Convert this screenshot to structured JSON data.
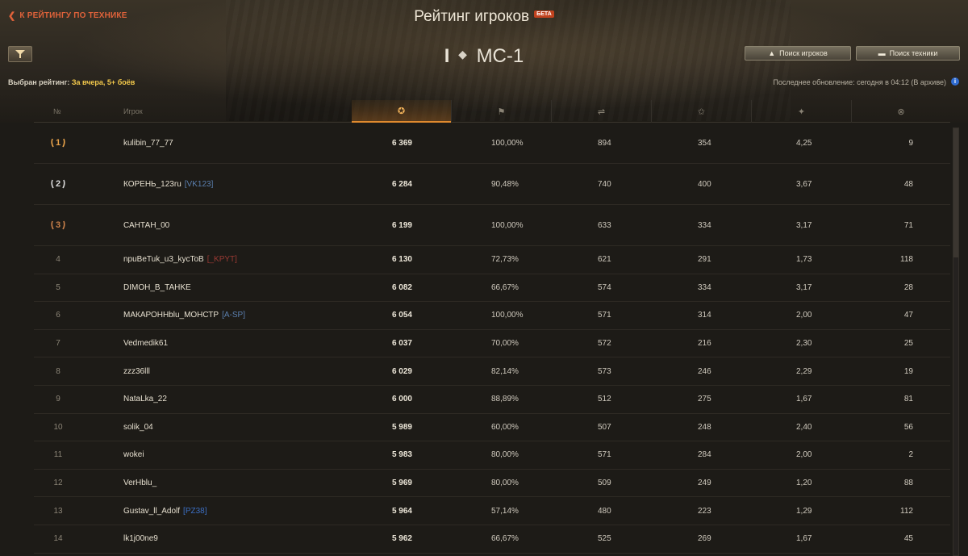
{
  "header": {
    "back_label": "К РЕЙТИНГУ ПО ТЕХНИКЕ",
    "title": "Рейтинг игроков",
    "beta": "БЕТА",
    "tank_tier": "I",
    "tank_name": "МС-1",
    "search_players": "Поиск игроков",
    "search_tech": "Поиск техники",
    "selected_label": "Выбран рейтинг:",
    "selected_value": "За вчера, 5+ боёв",
    "update_info": "Последнее обновление: сегодня в 04:12 (В архиве)"
  },
  "columns": {
    "num": "№",
    "player": "Игрок",
    "rating_icon": "rating-icon",
    "wins_icon": "flag-icon",
    "battles_icon": "battles-icon",
    "exp_icon": "star-icon",
    "damage_icon": "damage-icon",
    "frags_icon": "frags-icon"
  },
  "accent_colors": {
    "back_link": "#e0623a",
    "selected_value": "#f2c84b",
    "sorted_column": "#e08a2e"
  },
  "rows": [
    {
      "pos": "1",
      "name": "kulibin_77_77",
      "clan": "",
      "clan_color": "",
      "rating": "6 369",
      "wins": "100,00%",
      "battles": "894",
      "exp": "354",
      "dmg": "4,25",
      "frags": "9"
    },
    {
      "pos": "2",
      "name": "КОРЕНЬ_123ru",
      "clan": "[VK123]",
      "clan_color": "#5a7fae",
      "rating": "6 284",
      "wins": "90,48%",
      "battles": "740",
      "exp": "400",
      "dmg": "3,67",
      "frags": "48"
    },
    {
      "pos": "3",
      "name": "САНТАН_00",
      "clan": "",
      "clan_color": "",
      "rating": "6 199",
      "wins": "100,00%",
      "battles": "633",
      "exp": "334",
      "dmg": "3,17",
      "frags": "71"
    },
    {
      "pos": "4",
      "name": "npuBeTuk_u3_kycToB",
      "clan": "[_KPYT]",
      "clan_color": "#9b3a34",
      "rating": "6 130",
      "wins": "72,73%",
      "battles": "621",
      "exp": "291",
      "dmg": "1,73",
      "frags": "118"
    },
    {
      "pos": "5",
      "name": "DIMOH_B_TAHKE",
      "clan": "",
      "clan_color": "",
      "rating": "6 082",
      "wins": "66,67%",
      "battles": "574",
      "exp": "334",
      "dmg": "3,17",
      "frags": "28"
    },
    {
      "pos": "6",
      "name": "МАКАРОННblu_МОНСТР",
      "clan": "[A-SP]",
      "clan_color": "#5a7fae",
      "rating": "6 054",
      "wins": "100,00%",
      "battles": "571",
      "exp": "314",
      "dmg": "2,00",
      "frags": "47"
    },
    {
      "pos": "7",
      "name": "Vedmedik61",
      "clan": "",
      "clan_color": "",
      "rating": "6 037",
      "wins": "70,00%",
      "battles": "572",
      "exp": "216",
      "dmg": "2,30",
      "frags": "25"
    },
    {
      "pos": "8",
      "name": "zzz36lll",
      "clan": "",
      "clan_color": "",
      "rating": "6 029",
      "wins": "82,14%",
      "battles": "573",
      "exp": "246",
      "dmg": "2,29",
      "frags": "19"
    },
    {
      "pos": "9",
      "name": "NataLka_22",
      "clan": "",
      "clan_color": "",
      "rating": "6 000",
      "wins": "88,89%",
      "battles": "512",
      "exp": "275",
      "dmg": "1,67",
      "frags": "81"
    },
    {
      "pos": "10",
      "name": "solik_04",
      "clan": "",
      "clan_color": "",
      "rating": "5 989",
      "wins": "60,00%",
      "battles": "507",
      "exp": "248",
      "dmg": "2,40",
      "frags": "56"
    },
    {
      "pos": "11",
      "name": "wokei",
      "clan": "",
      "clan_color": "",
      "rating": "5 983",
      "wins": "80,00%",
      "battles": "571",
      "exp": "284",
      "dmg": "2,00",
      "frags": "2"
    },
    {
      "pos": "12",
      "name": "VerHblu_",
      "clan": "",
      "clan_color": "",
      "rating": "5 969",
      "wins": "80,00%",
      "battles": "509",
      "exp": "249",
      "dmg": "1,20",
      "frags": "88"
    },
    {
      "pos": "13",
      "name": "Gustav_ll_Adolf",
      "clan": "[PZ38]",
      "clan_color": "#3c6fc4",
      "rating": "5 964",
      "wins": "57,14%",
      "battles": "480",
      "exp": "223",
      "dmg": "1,29",
      "frags": "112"
    },
    {
      "pos": "14",
      "name": "lk1j00ne9",
      "clan": "",
      "clan_color": "",
      "rating": "5 962",
      "wins": "66,67%",
      "battles": "525",
      "exp": "269",
      "dmg": "1,67",
      "frags": "45"
    }
  ]
}
